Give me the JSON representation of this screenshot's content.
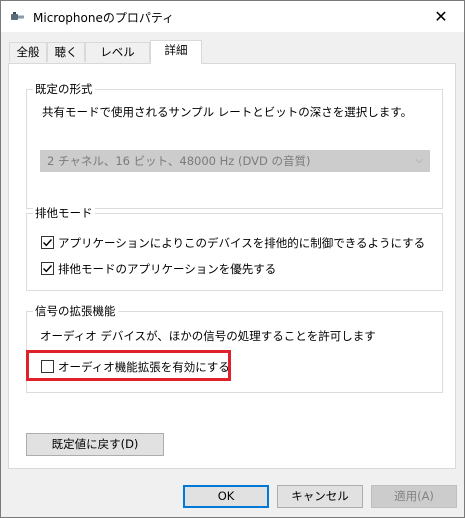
{
  "window": {
    "title": "Microphoneのプロパティ",
    "close_glyph": "✕",
    "icon": "microphone-icon"
  },
  "tabs": [
    {
      "label": "全般",
      "active": false
    },
    {
      "label": "聴く",
      "active": false
    },
    {
      "label": "レベル",
      "active": false
    },
    {
      "label": "詳細",
      "active": true
    }
  ],
  "default_format": {
    "group_title": "既定の形式",
    "description": "共有モードで使用されるサンプル レートとビットの深さを選択します。",
    "selected_format": "2 チャネル、16 ビット、48000 Hz (DVD の音質)",
    "chevron_glyph": "⌵"
  },
  "exclusive_mode": {
    "group_title": "排他モード",
    "options": [
      {
        "label": "アプリケーションによりこのデバイスを排他的に制御できるようにする",
        "checked": true
      },
      {
        "label": "排他モードのアプリケーションを優先する",
        "checked": true
      }
    ]
  },
  "signal_enhancements": {
    "group_title": "信号の拡張機能",
    "description": "オーディオ デバイスが、ほかの信号の処理することを許可します",
    "option": {
      "label": "オーディオ機能拡張を有効にする",
      "checked": false
    }
  },
  "restore_defaults_label": "既定値に戻す(D)",
  "footer": {
    "ok_label": "OK",
    "cancel_label": "キャンセル",
    "apply_label": "適用(A)"
  },
  "colors": {
    "highlight": "#e0202a",
    "accent": "#0078d7"
  }
}
